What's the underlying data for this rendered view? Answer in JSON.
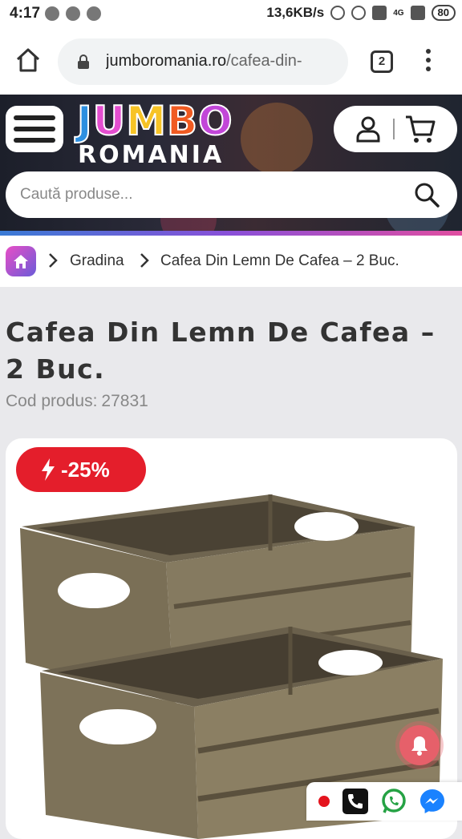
{
  "status_bar": {
    "time": "4:17",
    "network_speed": "13,6KB/s",
    "network_type": "4G",
    "battery": "80"
  },
  "browser": {
    "url_domain": "jumboromania.ro",
    "url_path": "/cafea-din-",
    "tab_count": "2"
  },
  "header": {
    "logo_top": "JUMBO",
    "logo_bottom": "ROMANIA",
    "logo_colors": [
      "#2d8fe0",
      "#e44ed0",
      "#f7c325",
      "#f05a22",
      "#c246d8"
    ],
    "search_placeholder": "Caută produse..."
  },
  "breadcrumb": {
    "items": [
      "Gradina",
      "Cafea Din Lemn De Cafea – 2 Buc."
    ]
  },
  "product": {
    "title": "Cafea Din Lemn De Cafea – 2 Buc.",
    "sku_label": "Cod produs:",
    "sku_value": "27831",
    "discount": "-25%"
  },
  "colors": {
    "discount_badge": "#e41e2b",
    "accent_gradient_start": "#3a7bd5",
    "accent_gradient_end": "#e04ea0"
  },
  "contact_icons": [
    "phone-icon",
    "whatsapp-icon",
    "messenger-icon"
  ]
}
